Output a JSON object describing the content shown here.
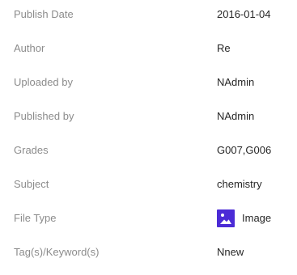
{
  "details": {
    "rows": [
      {
        "label": "Publish Date",
        "value": "2016-01-04"
      },
      {
        "label": "Author",
        "value": "Re"
      },
      {
        "label": "Uploaded by",
        "value": "NAdmin"
      },
      {
        "label": "Published by",
        "value": "NAdmin"
      },
      {
        "label": "Grades",
        "value": "G007,G006"
      },
      {
        "label": "Subject",
        "value": "chemistry"
      },
      {
        "label": "File Type",
        "value": "Image",
        "icon": "image-icon",
        "icon_color": "#4b2bd6"
      },
      {
        "label": "Tag(s)/Keyword(s)",
        "value": "Nnew"
      }
    ]
  }
}
